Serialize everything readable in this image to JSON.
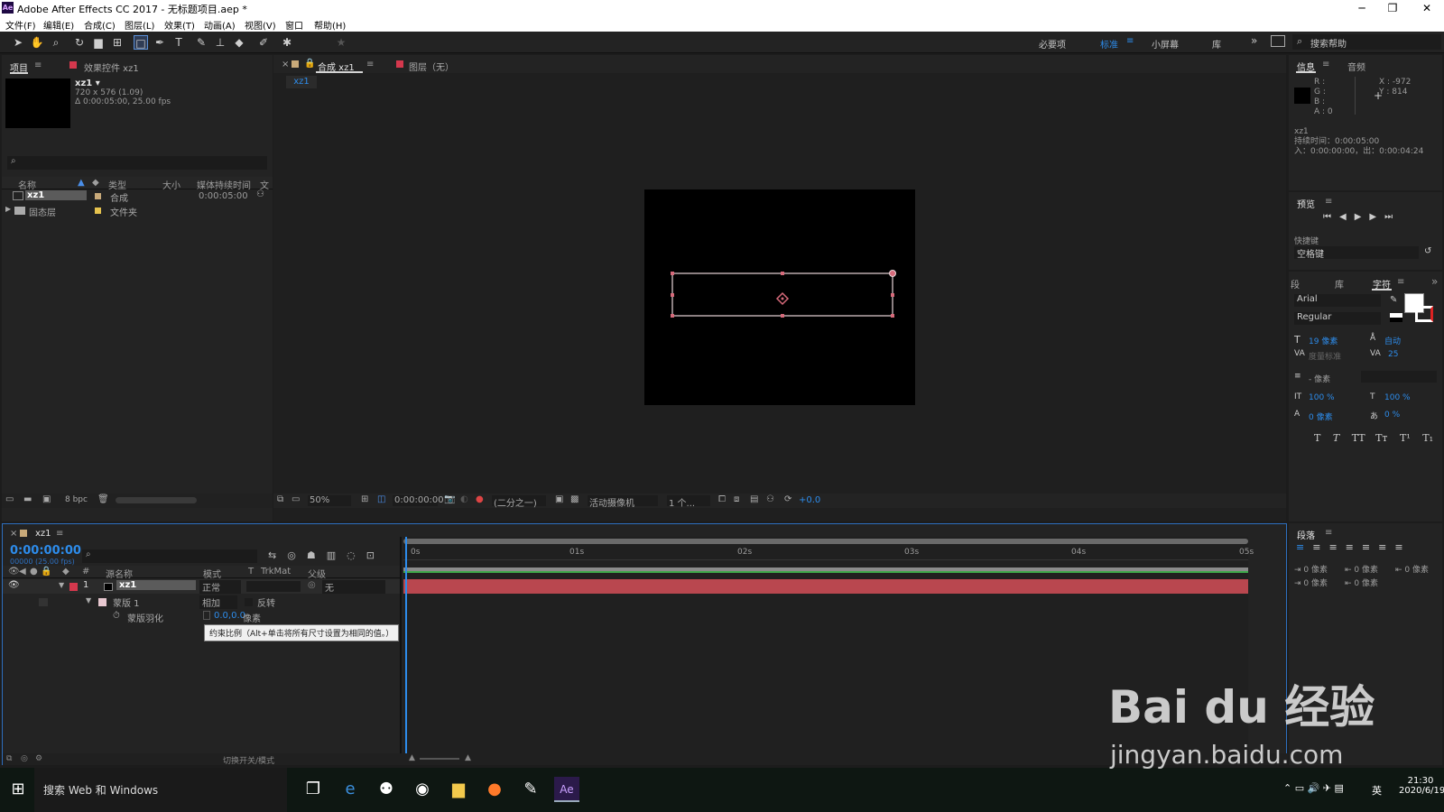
{
  "titlebar": {
    "app_icon": "Ae",
    "title": "Adobe After Effects CC 2017 - 无标题项目.aep *",
    "buttons": [
      "minimize-icon",
      "maximize-icon",
      "close-icon"
    ]
  },
  "menubar": {
    "items": [
      "文件(F)",
      "编辑(E)",
      "合成(C)",
      "图层(L)",
      "效果(T)",
      "动画(A)",
      "视图(V)",
      "窗口",
      "帮助(H)"
    ]
  },
  "toolbar": {
    "tools": [
      "selection-tool-icon",
      "hand-tool-icon",
      "zoom-tool-icon",
      "rotate-tool-icon",
      "camera-tool-icon",
      "pan-behind-tool-icon",
      "rectangle-tool-icon",
      "pen-tool-icon",
      "type-tool-icon",
      "brush-tool-icon",
      "clone-stamp-tool-icon",
      "eraser-tool-icon",
      "roto-brush-icon",
      "puppet-pin-icon"
    ],
    "workspaces": [
      "必要项",
      "标准",
      "小屏幕",
      "库"
    ],
    "active_workspace": "标准",
    "search_placeholder": "搜索帮助"
  },
  "project_panel": {
    "tab_project": "项目",
    "tab_effects": "效果控件 xz1",
    "comp_name": "xz1 ▾",
    "comp_size": "720 x 576 (1.09)",
    "comp_duration": "Δ 0:00:05:00, 25.00 fps",
    "search_placeholder": "",
    "columns": [
      "名称",
      "类型",
      "大小",
      "媒体持续时间",
      "文"
    ],
    "rows": [
      {
        "name": "xz1",
        "type": "合成",
        "size": "",
        "duration": "0:00:05:00",
        "color": "#c9aa7a"
      },
      {
        "name": "固态层",
        "type": "文件夹",
        "size": "",
        "duration": "",
        "color": "#e6c34e"
      }
    ],
    "bpc": "8 bpc"
  },
  "comp_panel": {
    "tab_comp": "合成 xz1",
    "tab_layer": "图层（无）",
    "sub_tab": "xz1",
    "zoom": "50%",
    "timecode": "0:00:00:00",
    "resolution": "(二分之一)",
    "camera": "活动摄像机",
    "views": "1 个...",
    "exposure": "+0.0"
  },
  "info_panel": {
    "tab_info": "信息",
    "tab_audio": "音频",
    "rgba": [
      "R :",
      "G :",
      "B :",
      "A : 0"
    ],
    "coords": [
      "X : -972",
      "Y : 814"
    ],
    "layer": "xz1",
    "duration": "持续时间：0:00:05:00",
    "in_out": "入：0:00:00:00，出：0:00:04:24"
  },
  "preview_panel": {
    "title": "预览",
    "shortcut_label": "快捷键",
    "shortcut_value": "空格键"
  },
  "char_panel": {
    "tabs": [
      "段",
      "库",
      "字符"
    ],
    "font": "Arial",
    "style": "Regular",
    "size": "19 像素",
    "leading": "自动",
    "kerning": "度量标准",
    "tracking": "25",
    "stroke": "- 像素",
    "vscale": "100 %",
    "hscale": "100 %",
    "baseline": "0 像素",
    "tsume": "0 %",
    "styles": [
      "T",
      "T",
      "TT",
      "Tт",
      "T¹",
      "T₁"
    ]
  },
  "para_panel": {
    "title": "段落",
    "indent_values": [
      "0 像素",
      "0 像素",
      "0 像素",
      "0 像素",
      "0 像素"
    ]
  },
  "timeline": {
    "tab": "xz1",
    "timecode": "0:00:00:00",
    "frames": "00000 (25.00 fps)",
    "columns": [
      "源名称",
      "模式",
      "T",
      "TrkMat",
      "父级"
    ],
    "ruler": [
      "0s",
      "01s",
      "02s",
      "03s",
      "04s",
      "05s"
    ],
    "layer": {
      "index": "1",
      "name": "xz1",
      "mode": "正常",
      "parent": "无"
    },
    "mask": {
      "name": "蒙版 1",
      "mode": "相加",
      "invert": "反转"
    },
    "feather": {
      "label": "蒙版羽化",
      "value": "0.0,0.0",
      "unit": "像素"
    },
    "tooltip": "约束比例（Alt+单击将所有尺寸设置为相同的值。）",
    "bottom_label": "切换开关/模式"
  },
  "taskbar": {
    "search": "搜索 Web 和 Windows",
    "time": "21:30",
    "date": "2020/6/19",
    "ime": "英"
  },
  "watermark": {
    "text": "Bai du 经验",
    "url": "jingyan.baidu.com"
  }
}
